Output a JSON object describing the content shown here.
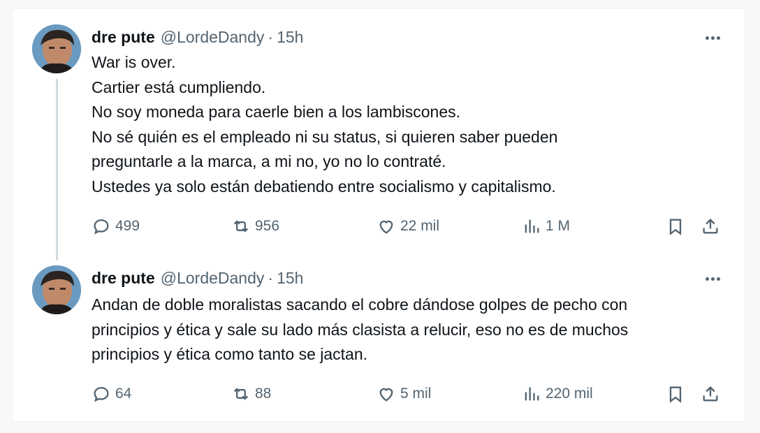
{
  "tweets": [
    {
      "name": "dre pute",
      "handle": "@LordeDandy",
      "separator": "·",
      "time": "15h",
      "lines": [
        "War is over.",
        "Cartier está cumpliendo.",
        "No soy moneda para caerle bien a los lambiscones.",
        "No sé quién es el empleado ni su status, si quieren saber pueden",
        "preguntarle a la marca, a mi no, yo no lo contraté.",
        "Ustedes ya solo están debatiendo entre socialismo y capitalismo."
      ],
      "stats": {
        "replies": "499",
        "reposts": "956",
        "likes": "22 mil",
        "views": "1 M"
      }
    },
    {
      "name": "dre pute",
      "handle": "@LordeDandy",
      "separator": "·",
      "time": "15h",
      "lines": [
        "Andan de doble moralistas sacando el cobre dándose golpes de pecho con",
        "principios y ética  y sale su lado más clasista a relucir, eso no es de muchos",
        "principios y ética como tanto se jactan."
      ],
      "stats": {
        "replies": "64",
        "reposts": "88",
        "likes": "5 mil",
        "views": "220 mil"
      }
    }
  ],
  "icons": {
    "reply": "speech-bubble-icon",
    "repost": "repost-arrows-icon",
    "like": "heart-icon",
    "views": "bar-chart-icon",
    "bookmark": "bookmark-icon",
    "share": "share-upload-icon",
    "more": "more-dots-icon"
  },
  "colors": {
    "text": "#0f1419",
    "muted": "#536471",
    "thread_line": "#cfd9de"
  }
}
